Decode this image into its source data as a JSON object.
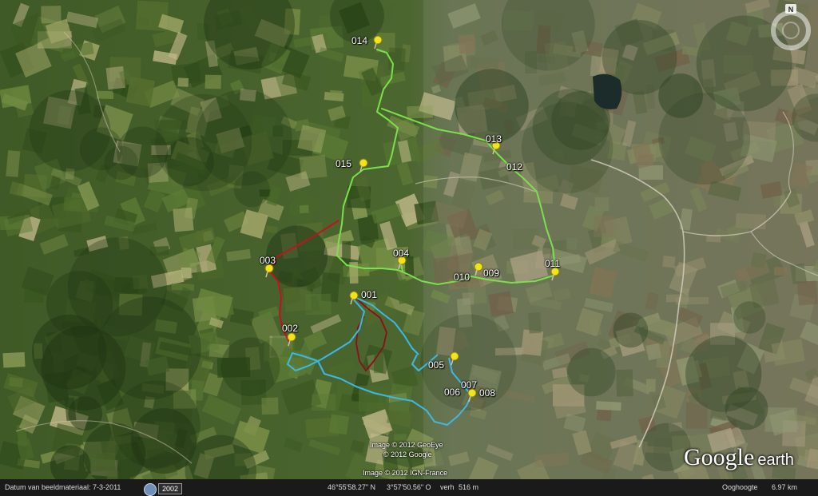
{
  "colors": {
    "route_green": "#7be04a",
    "route_red": "#c0141c",
    "route_darkred": "#8a1018",
    "route_blue": "#3cb8e6",
    "pin_yellow": "#f2e41c"
  },
  "waypoints": {
    "w001": "001",
    "w002": "002",
    "w003": "003",
    "w004": "004",
    "w005": "005",
    "w006": "006",
    "w007": "007",
    "w008": "008",
    "w009": "009",
    "w010": "010",
    "w011": "011",
    "w012": "012",
    "w013": "013",
    "w014": "014",
    "w015": "015"
  },
  "credits": {
    "geoeye": "Image © 2012 GeoEye",
    "google": "© 2012 Google",
    "ign": "Image © 2012 IGN-France"
  },
  "logo": {
    "main": "Google",
    "sub": "earth"
  },
  "compass": {
    "north": "N"
  },
  "statusbar": {
    "imagery_date": "Datum van beeldmateriaal: 7-3-2011",
    "year": "2002",
    "latitude": "46°55'58.27\" N",
    "longitude": "3°57'50.56\" O",
    "elevation_label": "verh",
    "elevation_value": "516 m",
    "eye_label": "Ooghoogte",
    "eye_value": "6.97 km"
  }
}
